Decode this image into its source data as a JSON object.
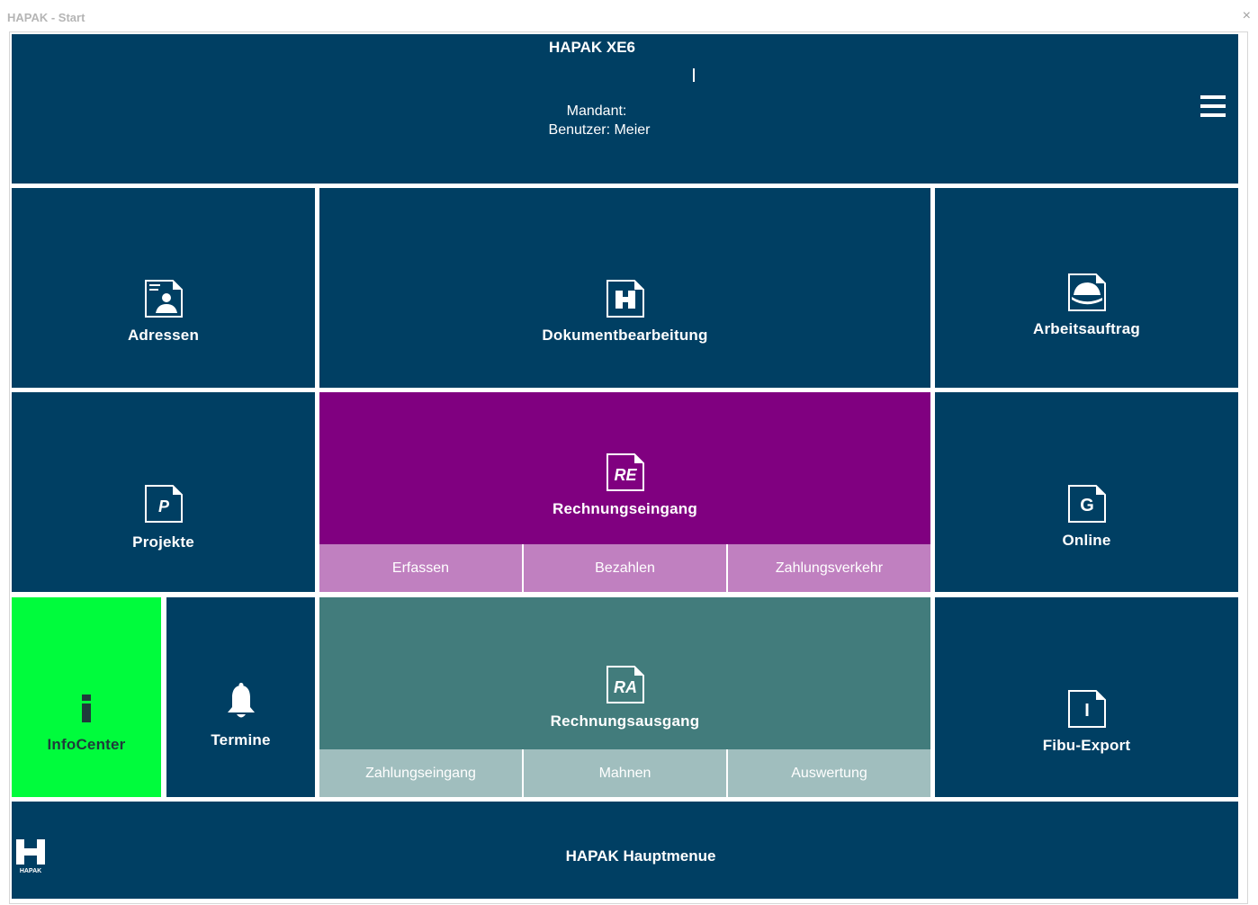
{
  "window": {
    "title": "HAPAK - Start",
    "close_glyph": "×"
  },
  "header": {
    "app_title": "HAPAK XE6",
    "mandant": "Mandant:",
    "benutzer": "Benutzer: Meier",
    "menu_icon": "hamburger-menu-icon"
  },
  "tiles": {
    "adressen": {
      "label": "Adressen",
      "icon": "address-card-icon"
    },
    "dokumentbearbeitung": {
      "label": "Dokumentbearbeitung",
      "icon": "hapak-document-icon"
    },
    "arbeitsauftrag": {
      "label": "Arbeitsauftrag",
      "icon": "hard-hat-icon"
    },
    "projekte": {
      "label": "Projekte",
      "icon": "project-document-icon",
      "icon_text": "P"
    },
    "rechnungseingang": {
      "label": "Rechnungseingang",
      "icon": "incoming-invoice-icon",
      "icon_text": "RE",
      "sub": [
        "Erfassen",
        "Bezahlen",
        "Zahlungsverkehr"
      ]
    },
    "online": {
      "label": "Online",
      "icon": "online-document-icon",
      "icon_text": "G"
    },
    "infocenter": {
      "label": "InfoCenter",
      "icon": "info-icon"
    },
    "termine": {
      "label": "Termine",
      "icon": "bell-icon"
    },
    "rechnungsausgang": {
      "label": "Rechnungsausgang",
      "icon": "outgoing-invoice-icon",
      "icon_text": "RA",
      "sub": [
        "Zahlungseingang",
        "Mahnen",
        "Auswertung"
      ]
    },
    "fibu_export": {
      "label": "Fibu-Export",
      "icon": "export-document-icon",
      "icon_text": "I"
    }
  },
  "footer": {
    "title": "HAPAK  Hauptmenue",
    "logo_text": "HAPAK"
  },
  "colors": {
    "tile": "#003f63",
    "rechnungseingang": "#800080",
    "rechnungseingang_sub": "#c080c0",
    "rechnungsausgang": "#427c7c",
    "rechnungsausgang_sub": "#a0bebe",
    "infocenter": "#00fc3c"
  }
}
